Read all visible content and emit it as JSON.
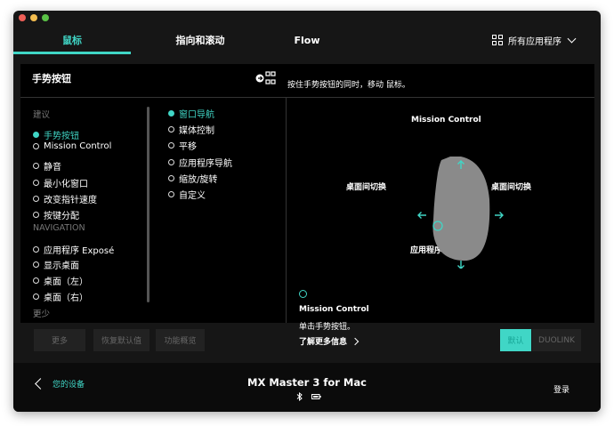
{
  "tabs": [
    {
      "label": "鼠标",
      "active": true
    },
    {
      "label": "指向和滚动",
      "active": false
    },
    {
      "label": "Flow",
      "active": false
    }
  ],
  "apps_menu": {
    "label": "所有应用程序",
    "icon": "grid-icon"
  },
  "panel": {
    "title": "手势按钮",
    "hint": "按住手势按钮的同时，移动 鼠标。"
  },
  "left_list": {
    "section_suggested": "建议",
    "suggested": [
      {
        "label": "手势按钮",
        "selected": true
      },
      {
        "label": "Mission Control",
        "selected": false
      },
      {
        "label": "静音",
        "selected": false
      },
      {
        "label": "最小化窗口",
        "selected": false
      },
      {
        "label": "改变指针速度",
        "selected": false
      },
      {
        "label": "按键分配",
        "selected": false
      }
    ],
    "section_navigation": "NAVIGATION",
    "navigation": [
      {
        "label": "应用程序 Exposé",
        "selected": false
      },
      {
        "label": "显示桌面",
        "selected": false
      },
      {
        "label": "桌面（左）",
        "selected": false
      },
      {
        "label": "桌面（右）",
        "selected": false
      }
    ],
    "less": "更少"
  },
  "mid_list": [
    {
      "label": "窗口导航",
      "selected": true
    },
    {
      "label": "媒体控制",
      "selected": false
    },
    {
      "label": "平移",
      "selected": false
    },
    {
      "label": "应用程序导航",
      "selected": false
    },
    {
      "label": "缩放/旋转",
      "selected": false
    },
    {
      "label": "自定义",
      "selected": false
    }
  ],
  "diagram": {
    "up": "Mission Control",
    "left": "桌面间切换",
    "right": "桌面间切换",
    "down": "应用程序 Exposé"
  },
  "detail": {
    "title": "Mission Control",
    "description": "单击手势按钮。",
    "learn_more": "了解更多信息"
  },
  "buttons": {
    "more": "更多",
    "restore": "恢复默认值",
    "overview": "功能概览",
    "default": "默认",
    "duolink": "DUOLINK"
  },
  "footer": {
    "back": "您的设备",
    "device": "MX Master 3 for Mac",
    "signin": "登录"
  },
  "colors": {
    "accent": "#40d6c6",
    "background": "#161616",
    "panel": "#000000"
  }
}
